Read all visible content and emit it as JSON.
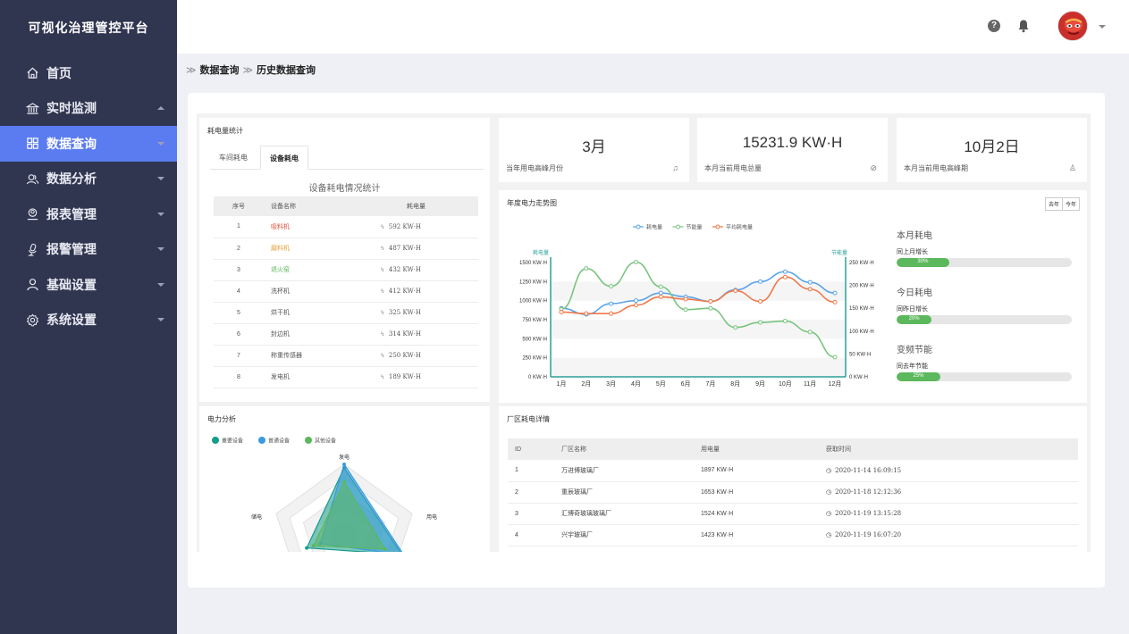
{
  "app": {
    "title": "可视化治理管控平台"
  },
  "sidebar": {
    "items": [
      {
        "label": "首页"
      },
      {
        "label": "实时监测"
      },
      {
        "label": "数据查询"
      },
      {
        "label": "数据分析"
      },
      {
        "label": "报表管理"
      },
      {
        "label": "报警管理"
      },
      {
        "label": "基础设置"
      },
      {
        "label": "系统设置"
      }
    ]
  },
  "topbar": {
    "help_glyph": "?"
  },
  "breadcrumb": {
    "sep": "≫",
    "items": [
      "数据查询",
      "历史数据查询"
    ]
  },
  "device_panel": {
    "title": "耗电量统计",
    "tabs": [
      "车间耗电",
      "设备耗电"
    ],
    "caption": "设备耗电情况统计",
    "headers": [
      "序号",
      "设备名称",
      "耗电量"
    ],
    "rows": [
      {
        "no": "1",
        "name": "吸料机",
        "value": "592 KW·H",
        "color": "#e0533c"
      },
      {
        "no": "2",
        "name": "磨料机",
        "value": "487 KW·H",
        "color": "#e6a23c"
      },
      {
        "no": "3",
        "name": "退火窑",
        "value": "432 KW·H",
        "color": "#5cb85c"
      },
      {
        "no": "4",
        "name": "洗杯机",
        "value": "412 KW·H",
        "color": "#555555"
      },
      {
        "no": "5",
        "name": "烘干机",
        "value": "325 KW·H",
        "color": "#555555"
      },
      {
        "no": "6",
        "name": "封边机",
        "value": "314 KW·H",
        "color": "#555555"
      },
      {
        "no": "7",
        "name": "称重传感器",
        "value": "250 KW·H",
        "color": "#555555"
      },
      {
        "no": "8",
        "name": "发电机",
        "value": "189 KW·H",
        "color": "#555555"
      }
    ]
  },
  "stats": [
    {
      "value": "3月",
      "label": "当年用电高峰月份",
      "icon": "♫"
    },
    {
      "value": "15231.9 KW·H",
      "label": "本月当前用电总量",
      "icon": "⊘"
    },
    {
      "value": "10月2日",
      "label": "本月当前用电高峰期",
      "icon": "♙"
    }
  ],
  "trend": {
    "title": "年度电力走势图",
    "range_buttons": [
      "去年",
      "今年"
    ],
    "side": [
      {
        "title": "本月耗电",
        "sub": "同上月增长",
        "percent": 30,
        "percent_label": "30%"
      },
      {
        "title": "今日耗电",
        "sub": "同昨日增长",
        "percent": 20,
        "percent_label": "20%"
      },
      {
        "title": "变频节能",
        "sub": "同去年节能",
        "percent": 25,
        "percent_label": "25%"
      }
    ]
  },
  "radar": {
    "title": "电力分析",
    "legend": [
      {
        "name": "重要设备",
        "color": "#169c8b"
      },
      {
        "name": "普通设备",
        "color": "#3a9ae0"
      },
      {
        "name": "其他设备",
        "color": "#5cb85c"
      }
    ],
    "indicators": [
      "发电",
      "用电",
      "储电"
    ]
  },
  "factory": {
    "title": "厂区耗电详情",
    "headers": [
      "ID",
      "厂区名称",
      "用电量",
      "获取时间"
    ],
    "rows": [
      {
        "id": "1",
        "name": "万进博玻璃厂",
        "value": "1897 KW·H",
        "time": "2020-11-14 16:09:15"
      },
      {
        "id": "2",
        "name": "重辰玻璃厂",
        "value": "1653 KW·H",
        "time": "2020-11-18 12:12:36"
      },
      {
        "id": "3",
        "name": "汇博奇玻璃玻璃厂",
        "value": "1524 KW·H",
        "time": "2020-11-19 13:15:28"
      },
      {
        "id": "4",
        "name": "兴宇玻璃厂",
        "value": "1423 KW·H",
        "time": "2020-11-19 16:07:20"
      }
    ]
  },
  "chart_data": [
    {
      "type": "line",
      "title": "年度电力走势图",
      "categories": [
        "1月",
        "2月",
        "3月",
        "4月",
        "5月",
        "6月",
        "7月",
        "8月",
        "9月",
        "10月",
        "11月",
        "12月"
      ],
      "ylabel": "耗电量",
      "y2label": "节能量",
      "ylim": [
        0,
        1500
      ],
      "y2lim": [
        0,
        250
      ],
      "yticks": [
        "0 KW·H",
        "250 KW·H",
        "500 KW·H",
        "750 KW·H",
        "1000 KW·H",
        "1250 KW·H",
        "1500 KW·H"
      ],
      "y2ticks": [
        "0 KW·H",
        "50 KW·H",
        "100 KW·H",
        "150 KW·H",
        "200 KW·H",
        "250 KW·H"
      ],
      "series": [
        {
          "name": "耗电量",
          "color": "#5aa3e8",
          "axis": "left",
          "values": [
            900,
            820,
            960,
            1000,
            1100,
            1050,
            990,
            1140,
            1250,
            1380,
            1240,
            1100
          ]
        },
        {
          "name": "节能量",
          "color": "#7ac47f",
          "axis": "right",
          "values": [
            148,
            237,
            198,
            251,
            197,
            147,
            150,
            108,
            119,
            122,
            98,
            43
          ]
        },
        {
          "name": "平均耗电量",
          "color": "#f0784a",
          "axis": "left",
          "values": [
            850,
            830,
            830,
            940,
            1050,
            1020,
            990,
            1130,
            990,
            1310,
            1150,
            980
          ]
        }
      ],
      "grid": true,
      "legend": "top-center"
    },
    {
      "type": "radar",
      "title": "电力分析",
      "indicators": [
        "发电",
        "用电",
        "储电"
      ],
      "series": [
        {
          "name": "重要设备",
          "color": "#169c8b",
          "values": [
            0.95,
            0.85,
            0.55
          ]
        },
        {
          "name": "普通设备",
          "color": "#3a9ae0",
          "values": [
            1.0,
            0.88,
            0.35
          ]
        },
        {
          "name": "其他设备",
          "color": "#5cb85c",
          "values": [
            0.75,
            0.6,
            0.45
          ]
        }
      ]
    }
  ]
}
